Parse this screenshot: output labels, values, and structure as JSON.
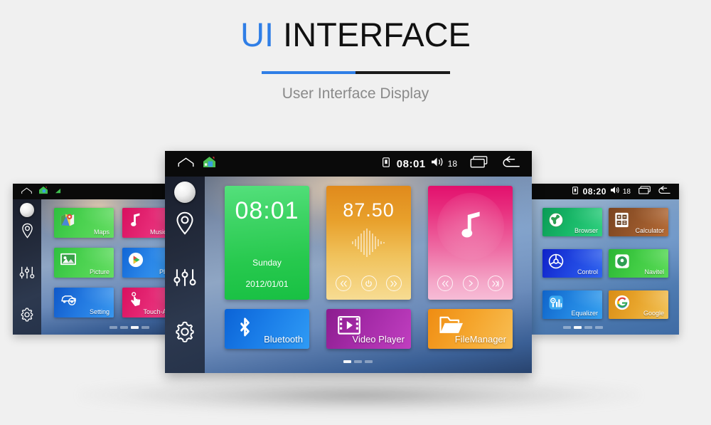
{
  "header": {
    "title_accent": "UI",
    "title_rest": " INTERFACE",
    "subtitle": "User Interface Display",
    "accent_color": "#2f7ee6",
    "rule_dark_color": "#1a1a1a"
  },
  "center_device": {
    "statusbar": {
      "home_icon": "home-arch-icon",
      "launcher_icon": "house-color-icon",
      "storage_icon": "sd-card-icon",
      "time": "08:01",
      "volume_icon": "volume-icon",
      "volume_level": "18",
      "recents_icon": "recents-icon",
      "back_icon": "back-arrow-icon"
    },
    "sidebar": {
      "knob": "round-knob",
      "items": [
        {
          "name": "location-pin-icon",
          "label": "Navigation"
        },
        {
          "name": "sliders-icon",
          "label": "Equalizer"
        },
        {
          "name": "gear-icon",
          "label": "Settings"
        }
      ]
    },
    "widgets": {
      "clock": {
        "time": "08:01",
        "weekday": "Sunday",
        "date": "2012/01/01",
        "color": "#27c94e"
      },
      "radio": {
        "frequency": "87.50",
        "prev": "«",
        "power": "⏻",
        "next": "»",
        "color": "#e8a02b"
      },
      "music": {
        "icon": "music-note-icon",
        "prev": "«",
        "play": "›",
        "next": "»",
        "color": "#e8307f"
      }
    },
    "tiles": [
      {
        "label": "Bluetooth",
        "icon": "bluetooth-icon",
        "class": "bt-bluetooth"
      },
      {
        "label": "Video Player",
        "icon": "video-player-icon",
        "class": "bt-video"
      },
      {
        "label": "FileManager",
        "icon": "folder-icon",
        "class": "bt-file"
      }
    ],
    "page_dots": {
      "count": 3,
      "active": 0
    }
  },
  "left_device": {
    "statusbar": {
      "home_icon": "home-arch-icon",
      "launcher_icon": "house-color-icon",
      "signal_icon": "signal-icon",
      "storage_icon": "sd-card-icon"
    },
    "sidebar": {
      "items": [
        {
          "name": "location-pin-icon"
        },
        {
          "name": "sliders-icon"
        },
        {
          "name": "gear-icon"
        }
      ]
    },
    "apps": [
      {
        "label": "Maps",
        "icon": "maps-icon",
        "class": "g-maps"
      },
      {
        "label": "Music Pla",
        "icon": "music-note-icon",
        "class": "g-music"
      },
      {
        "label": "Picture",
        "icon": "picture-icon",
        "class": "g-picture"
      },
      {
        "label": "Play S",
        "icon": "play-store-icon",
        "class": "g-play"
      },
      {
        "label": "Setting",
        "icon": "car-setting-icon",
        "class": "g-setting"
      },
      {
        "label": "Touch-Assis",
        "icon": "touch-hand-icon",
        "class": "g-touch"
      }
    ],
    "page_dots": {
      "count": 4,
      "active": 2
    }
  },
  "right_device": {
    "statusbar": {
      "storage_icon": "sd-card-icon",
      "time": "08:20",
      "volume_icon": "volume-icon",
      "volume_level": "18",
      "recents_icon": "recents-icon",
      "back_icon": "back-arrow-icon"
    },
    "apps": [
      {
        "label": "Browser",
        "icon": "globe-icon",
        "class": "g-browser"
      },
      {
        "label": "Calculator",
        "icon": "calculator-icon",
        "class": "g-calc"
      },
      {
        "label": "Control",
        "icon": "steering-wheel-icon",
        "class": "g-control"
      },
      {
        "label": "Navitel",
        "icon": "navitel-icon",
        "class": "g-navitel"
      },
      {
        "label": "Equalizer",
        "icon": "equalizer-icon",
        "class": "g-equalizer"
      },
      {
        "label": "Google",
        "icon": "google-g-icon",
        "class": "g-google"
      }
    ],
    "page_dots": {
      "count": 4,
      "active": 1
    }
  }
}
